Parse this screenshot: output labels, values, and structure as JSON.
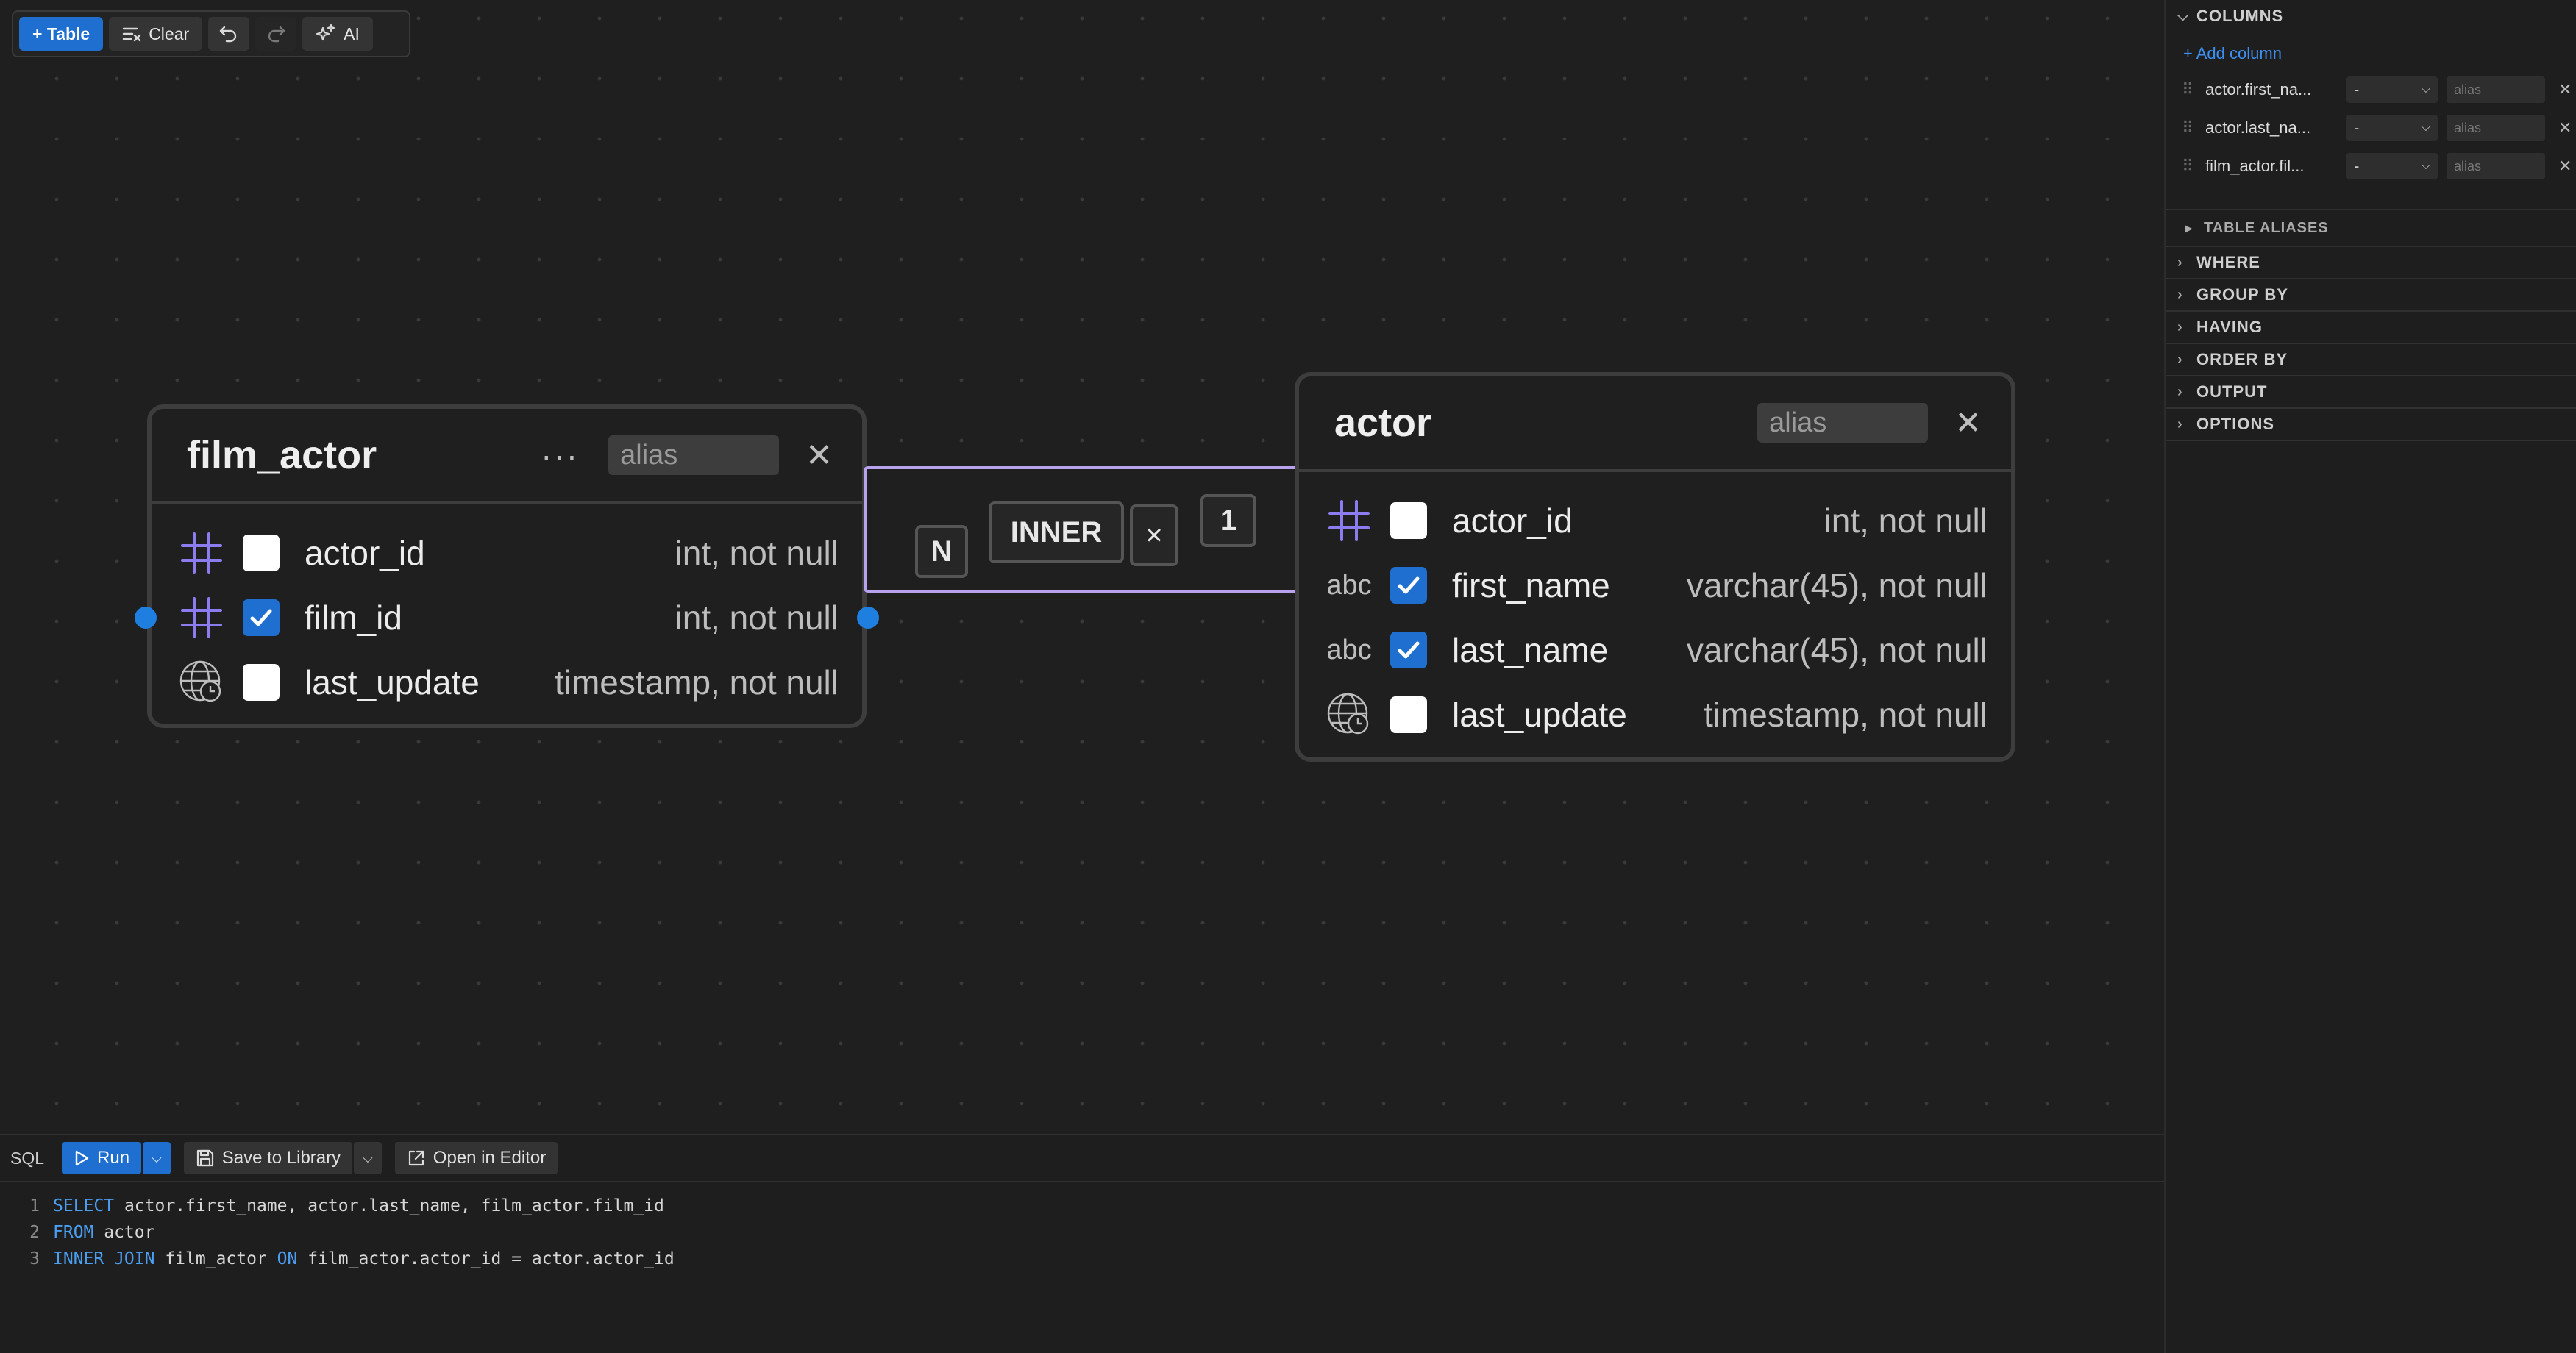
{
  "toolbar": {
    "add_table": "+ Table",
    "clear": "Clear",
    "ai": "AI"
  },
  "tables": [
    {
      "title": "film_actor",
      "alias_placeholder": "alias",
      "rows": [
        {
          "icon": "hash-icon",
          "name": "actor_id",
          "type": "int, not null",
          "checked": false
        },
        {
          "icon": "hash-icon",
          "name": "film_id",
          "type": "int, not null",
          "checked": true
        },
        {
          "icon": "clock-globe-icon",
          "name": "last_update",
          "type": "timestamp, not null",
          "checked": false
        }
      ]
    },
    {
      "title": "actor",
      "alias_placeholder": "alias",
      "rows": [
        {
          "icon": "hash-icon",
          "name": "actor_id",
          "type": "int, not null",
          "checked": false
        },
        {
          "icon": "abc-icon",
          "icon_text": "abc",
          "name": "first_name",
          "type": "varchar(45), not null",
          "checked": true
        },
        {
          "icon": "abc-icon",
          "icon_text": "abc",
          "name": "last_name",
          "type": "varchar(45), not null",
          "checked": true
        },
        {
          "icon": "clock-globe-icon",
          "name": "last_update",
          "type": "timestamp, not null",
          "checked": false
        }
      ]
    }
  ],
  "join": {
    "left_cardinality": "N",
    "type": "INNER",
    "remove": "×",
    "right_cardinality": "1"
  },
  "colors": {
    "accent": "#1e6fd0",
    "join_outline": "#b7a2ee",
    "hash_icon": "#8b7cf0"
  },
  "panel": {
    "columns_title": "COLUMNS",
    "add_column": "+ Add column",
    "columns": [
      {
        "name": "actor.first_na...",
        "agg": "-",
        "alias_placeholder": "alias"
      },
      {
        "name": "actor.last_na...",
        "agg": "-",
        "alias_placeholder": "alias"
      },
      {
        "name": "film_actor.fil...",
        "agg": "-",
        "alias_placeholder": "alias"
      }
    ],
    "sections": [
      "TABLE ALIASES",
      "WHERE",
      "GROUP BY",
      "HAVING",
      "ORDER BY",
      "OUTPUT",
      "OPTIONS"
    ]
  },
  "sql": {
    "label": "SQL",
    "run": "Run",
    "save": "Save to Library",
    "open": "Open in Editor",
    "lines": [
      {
        "num": "1",
        "kw": "SELECT",
        "rest": " actor.first_name, actor.last_name, film_actor.film_id"
      },
      {
        "num": "2",
        "kw": "FROM",
        "rest": " actor"
      },
      {
        "num": "3",
        "kw": "INNER JOIN",
        "rest": " film_actor ",
        "kw2": "ON",
        "rest2": " film_actor.actor_id = actor.actor_id"
      }
    ]
  }
}
